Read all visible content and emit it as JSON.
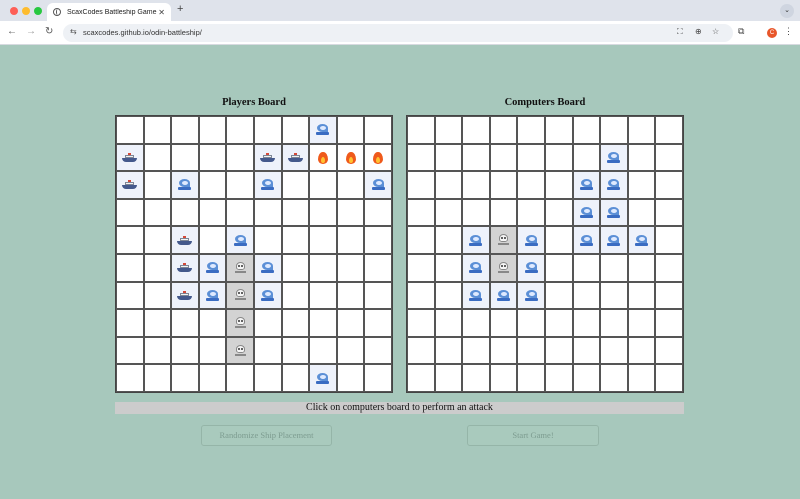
{
  "browser": {
    "tab_title": "ScaxCodes Battleship Game",
    "tab_close": "✕",
    "new_tab": "+",
    "tab_menu": "⌄",
    "nav": {
      "back": "←",
      "forward": "→",
      "reload": "↻"
    },
    "site_info": "⇆",
    "url": "scaxcodes.github.io/odin-battleship/",
    "translate_icon": "⛶",
    "zoom_icon": "⊕",
    "star_icon": "☆",
    "extensions_icon": "⧉",
    "profile_initial": "C",
    "menu_icon": "⋮"
  },
  "game": {
    "player_board_title": "Players Board",
    "computer_board_title": "Computers Board",
    "status_text": "Click on computers board to perform an attack",
    "randomize_button": "Randomize Ship Placement",
    "start_button": "Start Game!"
  },
  "legend": {
    "s": "ship",
    "w": "splash-miss",
    "x": "sunk",
    "f": "hit-fire",
    ".": "empty"
  },
  "player_board": [
    ".......w..",
    "s....ssfff",
    "s.w..w...w",
    "..........",
    "..s.w.....",
    "..swxw....",
    "..swxw....",
    "....x.....",
    "....x.....",
    ".......w.."
  ],
  "computer_board": [
    "..........",
    ".......w..",
    "......ww..",
    "......ww..",
    "..wxw.www.",
    "..wxw.....",
    "..www.....",
    "..........",
    "..........",
    ".........."
  ]
}
